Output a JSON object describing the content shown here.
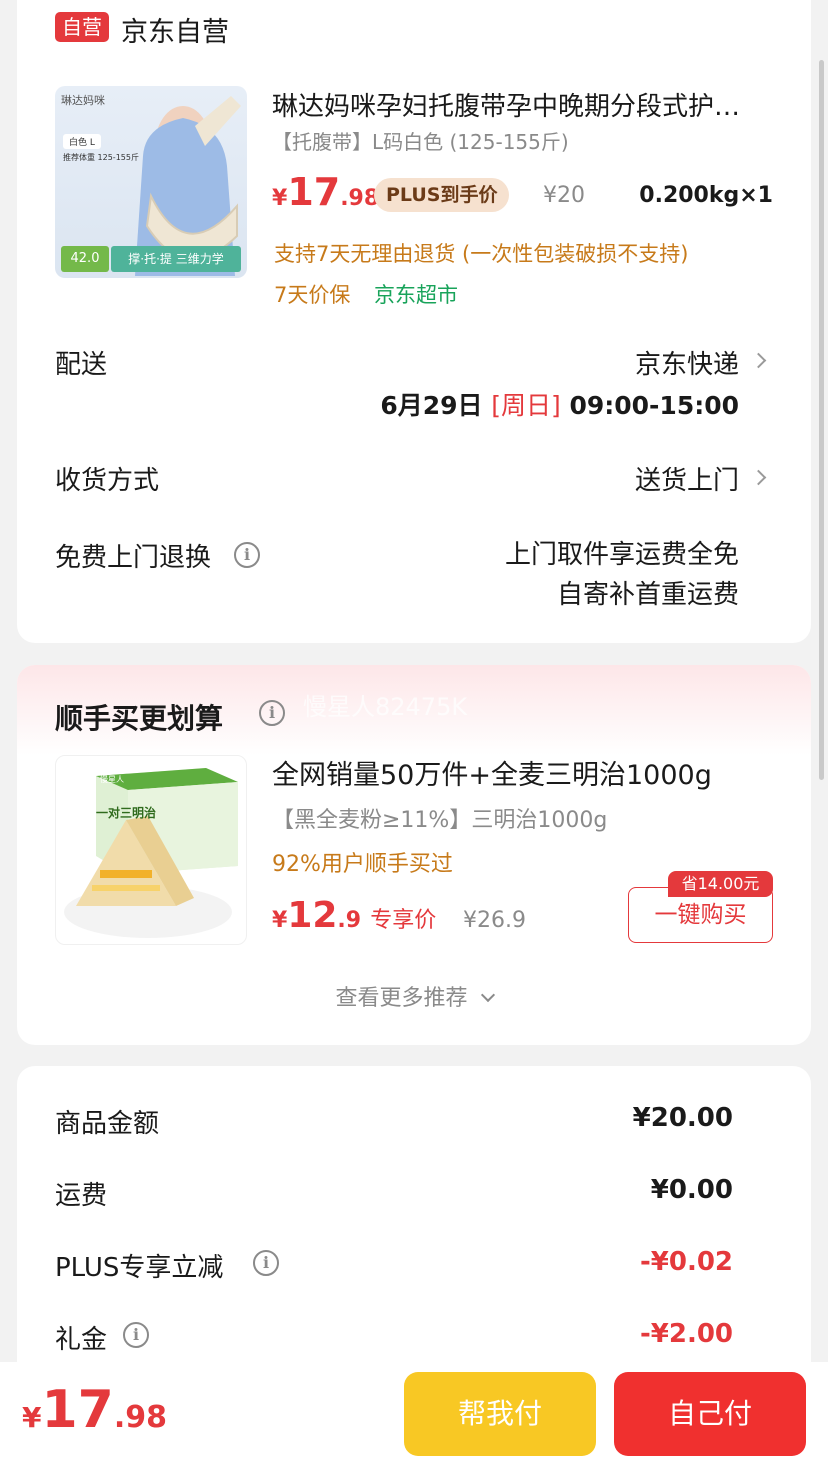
{
  "store": {
    "badge": "自营",
    "name": "京东自营"
  },
  "product": {
    "title": "琳达妈咪孕妇托腹带孕中晚期分段式护…",
    "spec": "【托腹带】L码白色 (125-155斤)",
    "price_symbol": "¥",
    "price_int": "17",
    "price_dec": ".98",
    "plus_tag": "PLUS到手价",
    "orig_price": "¥20",
    "weight_qty": "0.200kg×1",
    "return_policy": "支持7天无理由退货 (一次性包装破损不支持)",
    "tag_price_protect": "7天价保",
    "tag_store": "京东超市",
    "image": {
      "brand": "琳达妈咪",
      "color_tag": "白色 L",
      "weight_note": "推荐体重 125-155斤",
      "badge_num": "42.0",
      "banner": "撑·托·提 三维力学"
    }
  },
  "delivery": {
    "label": "配送",
    "carrier": "京东快递",
    "date": "6月29日",
    "weekday": "[周日]",
    "time": "09:00-15:00"
  },
  "receive": {
    "label": "收货方式",
    "value": "送货上门"
  },
  "free_return": {
    "label": "免费上门退换",
    "line1": "上门取件享运费全免",
    "line2": "自寄补首重运费"
  },
  "recommend": {
    "title": "顺手买更划算",
    "watermark": "慢星人82475K",
    "item_title": "全网销量50万件+全麦三明治1000g",
    "item_spec": "【黑全麦粉≥11%】三明治1000g",
    "item_stat": "92%用户顺手买过",
    "price_symbol": "¥",
    "price_int": "12",
    "price_dec": ".9",
    "price_tag": "专享价",
    "orig_price": "¥26.9",
    "save_badge": "省14.00元",
    "buy_button": "一键购买",
    "more": "查看更多推荐",
    "image": {
      "box_title": "一对三明治",
      "box_brand": "慢星人"
    }
  },
  "summary": {
    "rows": [
      {
        "label": "商品金额",
        "value": "¥20.00"
      },
      {
        "label": "运费",
        "value": "¥0.00"
      },
      {
        "label": "PLUS专享立减",
        "value": "-¥0.02"
      },
      {
        "label": "礼金",
        "value": "-¥2.00"
      }
    ]
  },
  "footer": {
    "price_symbol": "¥",
    "price_int": "17",
    "price_dec": ".98",
    "help_pay": "帮我付",
    "self_pay": "自己付"
  },
  "colors": {
    "accent_red": "#e4393c",
    "orange_text": "#c77a1a",
    "green_text": "#18a35a",
    "help_btn": "#f8c824",
    "self_btn": "#f0302f"
  },
  "icons": [
    "chevron-right-icon",
    "info-icon",
    "chevron-down-icon"
  ]
}
